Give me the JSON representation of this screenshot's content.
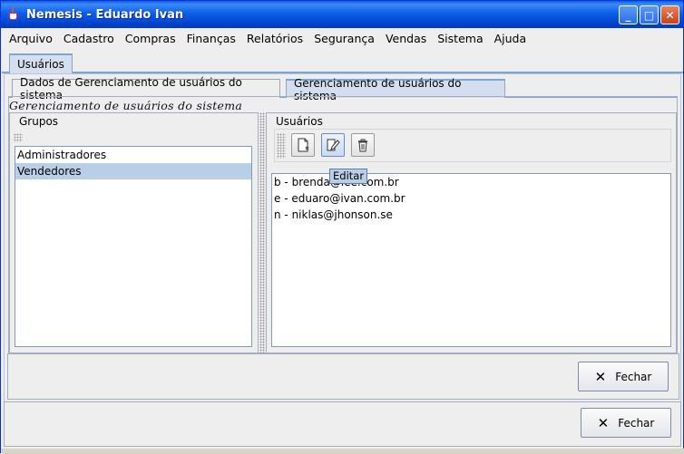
{
  "window": {
    "title": "Nemesis - Eduardo Ivan",
    "controls": {
      "minimize": "_",
      "maximize": "□",
      "close": "✕"
    }
  },
  "menu": [
    "Arquivo",
    "Cadastro",
    "Compras",
    "Finanças",
    "Relatórios",
    "Segurança",
    "Vendas",
    "Sistema",
    "Ajuda"
  ],
  "outer_tab": "Usuários",
  "inner_tabs": [
    {
      "label": "Dados de Gerenciamento de usuários do sistema",
      "active": false
    },
    {
      "label": "Gerenciamento de usuários do sistema",
      "active": true
    }
  ],
  "section_title": "Gerenciamento de usuários do sistema",
  "grupos": {
    "label": "Grupos",
    "items": [
      "Administradores",
      "Vendedores"
    ],
    "selected_index": 1
  },
  "usuarios": {
    "label": "Usuários",
    "items": [
      "b - brenda@lee.com.br",
      "e - eduaro@ivan.com.br",
      "n - niklas@jhonson.se"
    ],
    "toolbar": [
      "new-document-icon",
      "edit-icon",
      "trash-icon"
    ],
    "tooltip": "Editar"
  },
  "buttons": {
    "fechar_inner": "Fechar",
    "fechar_outer": "Fechar"
  },
  "colors": {
    "titlebar": "#0A5EE8",
    "selection": "#B8CFE5",
    "tab_active": "#D4DEEE"
  }
}
